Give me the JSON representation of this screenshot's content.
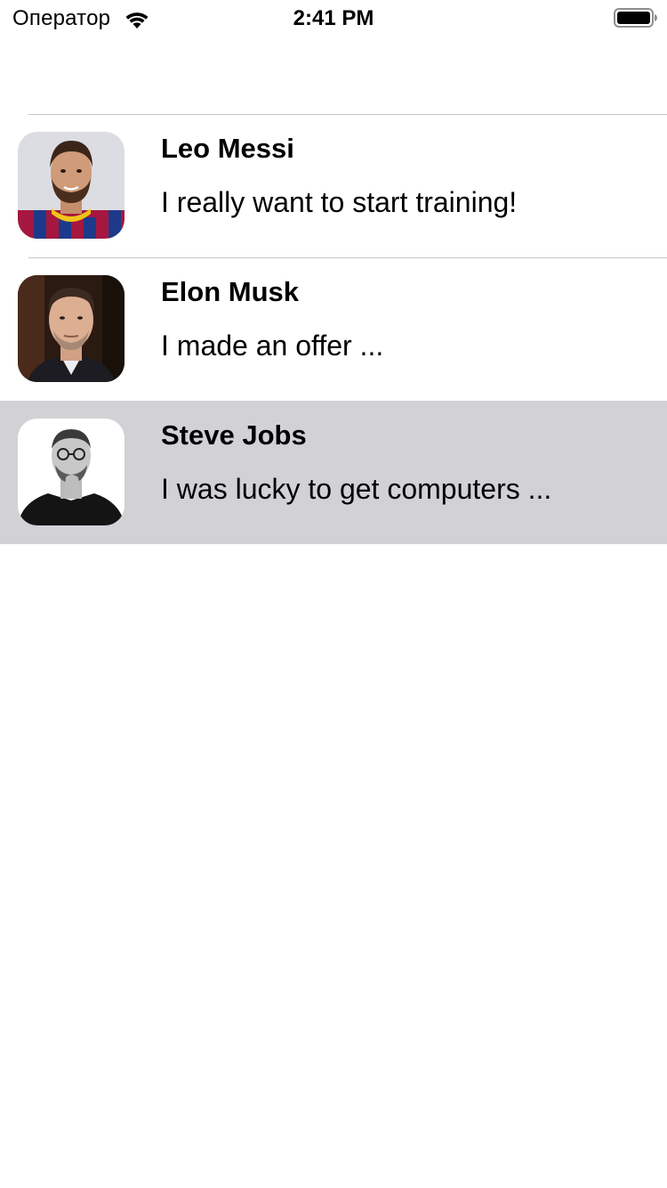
{
  "status_bar": {
    "carrier": "Оператор",
    "time": "2:41 PM",
    "icons": [
      "wifi-icon",
      "battery-icon"
    ]
  },
  "chats": [
    {
      "name": "Leo Messi",
      "message": "I really want to start training!",
      "avatar": "leo-messi-avatar",
      "selected": false
    },
    {
      "name": "Elon Musk",
      "message": "I made an offer ...",
      "avatar": "elon-musk-avatar",
      "selected": false
    },
    {
      "name": "Steve Jobs",
      "message": "I was lucky to get computers ...",
      "avatar": "steve-jobs-avatar",
      "selected": true
    }
  ],
  "colors": {
    "selected_row": "#d1d1d6",
    "separator": "#c6c6c8",
    "text": "#000000",
    "background": "#ffffff"
  }
}
